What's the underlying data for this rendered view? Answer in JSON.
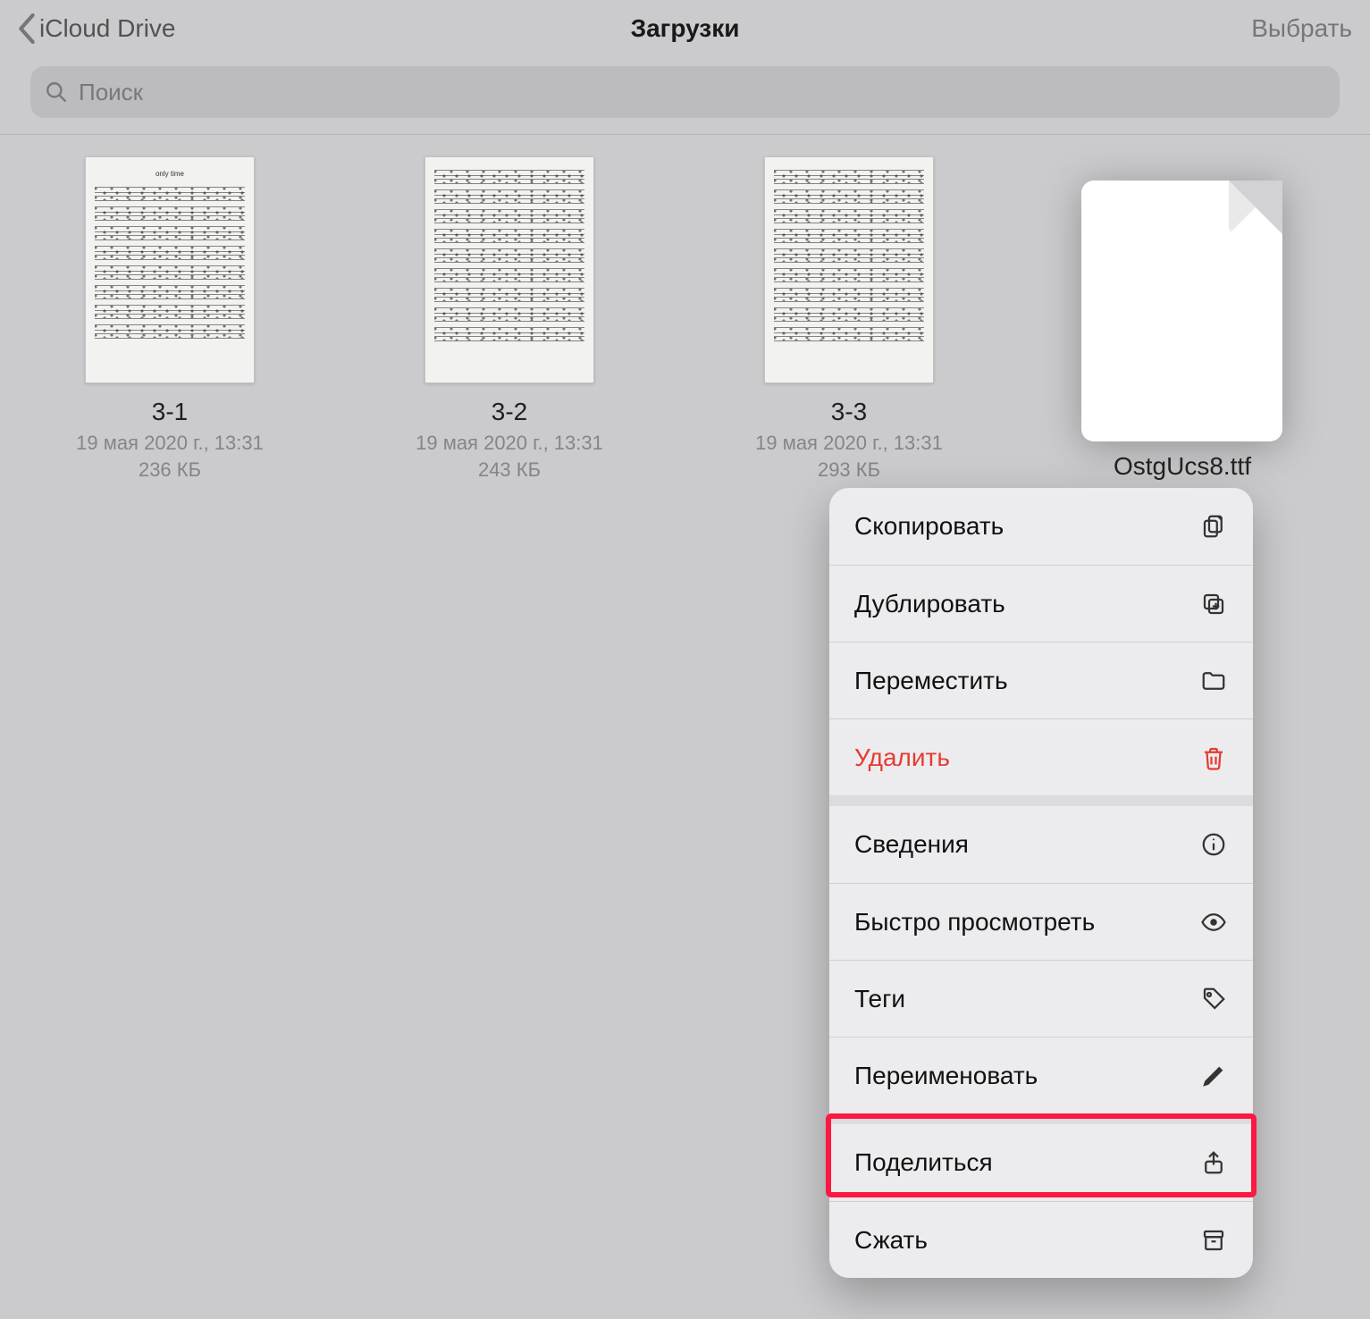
{
  "nav": {
    "back_label": "iCloud Drive",
    "title": "Загрузки",
    "select_label": "Выбрать"
  },
  "search": {
    "placeholder": "Поиск"
  },
  "files": [
    {
      "name": "3-1",
      "date": "19 мая 2020 г., 13:31",
      "size": "236 КБ",
      "thumb_title": "only time"
    },
    {
      "name": "3-2",
      "date": "19 мая 2020 г., 13:31",
      "size": "243 КБ",
      "thumb_title": ""
    },
    {
      "name": "3-3",
      "date": "19 мая 2020 г., 13:31",
      "size": "293 КБ",
      "thumb_title": ""
    }
  ],
  "selected_file": {
    "name": "OstgUcs8.ttf"
  },
  "context_menu": {
    "group1": [
      {
        "label": "Скопировать",
        "icon": "copy-icon"
      },
      {
        "label": "Дублировать",
        "icon": "duplicate-icon"
      },
      {
        "label": "Переместить",
        "icon": "folder-icon"
      },
      {
        "label": "Удалить",
        "icon": "trash-icon",
        "destructive": true
      }
    ],
    "group2": [
      {
        "label": "Сведения",
        "icon": "info-icon"
      },
      {
        "label": "Быстро просмотреть",
        "icon": "eye-icon"
      },
      {
        "label": "Теги",
        "icon": "tag-icon"
      },
      {
        "label": "Переименовать",
        "icon": "pencil-icon"
      }
    ],
    "group3": [
      {
        "label": "Поделиться",
        "icon": "share-icon",
        "highlighted": true
      },
      {
        "label": "Сжать",
        "icon": "archive-icon"
      }
    ]
  },
  "colors": {
    "destructive": "#e63b32",
    "highlight": "#ff1744"
  }
}
